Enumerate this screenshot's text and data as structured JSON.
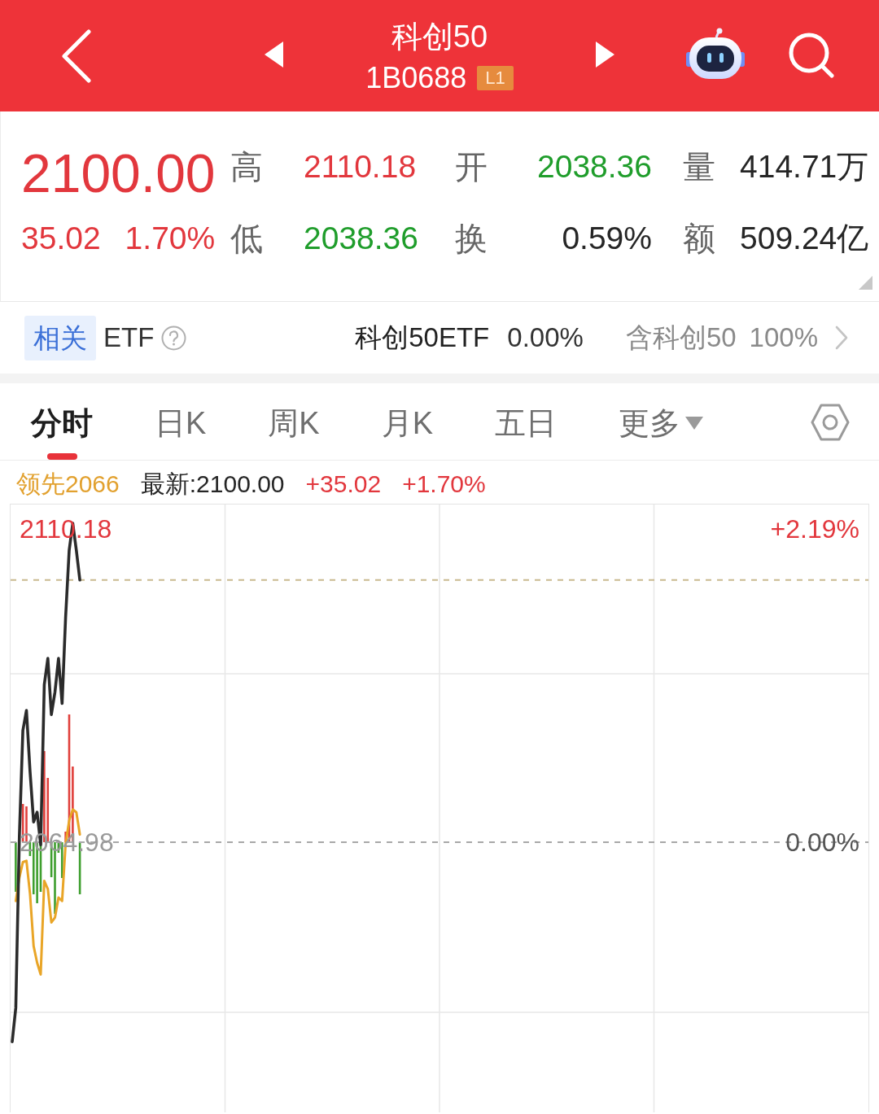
{
  "header": {
    "title": "科创50",
    "code": "1B0688",
    "level_badge": "L1"
  },
  "quote": {
    "price": {
      "text": "2100.00",
      "color": "#e2373d"
    },
    "change": {
      "text": "35.02",
      "color": "#e2373d"
    },
    "change_pct": {
      "text": "1.70%",
      "color": "#e2373d"
    },
    "stats": [
      {
        "label": "高",
        "value": "2110.18",
        "color": "#e2373d"
      },
      {
        "label": "开",
        "value": "2038.36",
        "color": "#1f9d2b"
      },
      {
        "label": "量",
        "value": "414.71万",
        "color": "#262626"
      },
      {
        "label": "低",
        "value": "2038.36",
        "color": "#1f9d2b"
      },
      {
        "label": "换",
        "value": "0.59%",
        "color": "#262626"
      },
      {
        "label": "额",
        "value": "509.24亿",
        "color": "#262626"
      }
    ]
  },
  "related_etf": {
    "tag": "相关",
    "title": "ETF",
    "etf_name": "科创50ETF",
    "etf_change": "0.00%",
    "holding_label": "含科创50",
    "holding_pct": "100%"
  },
  "tabs": [
    {
      "label": "分时",
      "selected": true,
      "kind": "tab"
    },
    {
      "label": "日K",
      "selected": false,
      "kind": "tab"
    },
    {
      "label": "周K",
      "selected": false,
      "kind": "tab"
    },
    {
      "label": "月K",
      "selected": false,
      "kind": "tab"
    },
    {
      "label": "五日",
      "selected": false,
      "kind": "tab"
    },
    {
      "label": "更多",
      "selected": false,
      "kind": "menu"
    }
  ],
  "indicator_line": [
    {
      "text": "领先2066",
      "kind": "leading"
    },
    {
      "text": "最新:2100.00",
      "kind": "latest"
    },
    {
      "text": "+35.02",
      "kind": "up"
    },
    {
      "text": "+1.70%",
      "kind": "up"
    }
  ],
  "chart": {
    "right_labels": [
      "+2.19%",
      "0.00%"
    ],
    "chart_data": {
      "type": "line",
      "categories": [
        null,
        null,
        null,
        null,
        null,
        null,
        null,
        null,
        null,
        null,
        null,
        null,
        null,
        null,
        null,
        null,
        null,
        null,
        null,
        null,
        null,
        null,
        null,
        null,
        null,
        null,
        null,
        null,
        null,
        null,
        null,
        null,
        null,
        null,
        null,
        null,
        null,
        null,
        null,
        null,
        null,
        null,
        null,
        null,
        null,
        null,
        null,
        null,
        null,
        null,
        null,
        null,
        null,
        null,
        null,
        null,
        null,
        null,
        null,
        null,
        null,
        null,
        null,
        null,
        null,
        null,
        null,
        null,
        null,
        null,
        null,
        null,
        null,
        null,
        null,
        null,
        null,
        null,
        null,
        null,
        null,
        null,
        null,
        null,
        null,
        null,
        null,
        null,
        null,
        null,
        null,
        null,
        null,
        null,
        null,
        null,
        null,
        null,
        null,
        null,
        null,
        null,
        null,
        null,
        null,
        null,
        null,
        null,
        null,
        null,
        null,
        null,
        null,
        null,
        null,
        null,
        null,
        null,
        null,
        null,
        null,
        null,
        null,
        null,
        null,
        null,
        null,
        null,
        null,
        null,
        null,
        null,
        null,
        null,
        null,
        null,
        null,
        null,
        null,
        null,
        null,
        null,
        null,
        null,
        null,
        null,
        null,
        null,
        null,
        null,
        null,
        null,
        null,
        null,
        null,
        null,
        null,
        null,
        null,
        null,
        null,
        null,
        null,
        null,
        null,
        null,
        null,
        null,
        null,
        null,
        null,
        null,
        null,
        null,
        null,
        null,
        null,
        null,
        null,
        null,
        null,
        null,
        null,
        null,
        null,
        null,
        null,
        null,
        null,
        null,
        null,
        null,
        null,
        null,
        null,
        null,
        null,
        null,
        null,
        null,
        null,
        null,
        null,
        null,
        null,
        null,
        null,
        null,
        null,
        null,
        null,
        null,
        null,
        null,
        null,
        null,
        null,
        null,
        null,
        null,
        null,
        null,
        null,
        null,
        null,
        null,
        null,
        null,
        null,
        null,
        null,
        null,
        null,
        null,
        null,
        null,
        null,
        null,
        null,
        null,
        null
      ],
      "ylim": [
        2026.0,
        2113.7
      ],
      "yticks": [
        {
          "value": 2110.18,
          "label": "2110.18"
        },
        {
          "value": 2064.98,
          "label": "2064.98"
        }
      ],
      "series": [
        {
          "color": "#e9a527",
          "values": [
            null,
            2056.5,
            2059.9,
            2062.1,
            2062.3,
            2057.5,
            2050.0,
            2047.6,
            2045.9,
            2059.4,
            2058.2,
            2053.4,
            2054.1,
            2057.0,
            2056.5,
            2064.7,
            2068.1,
            2069.7,
            2069.3,
            2066.1,
            null,
            null,
            null,
            null,
            null,
            null,
            null,
            null,
            null,
            null,
            null,
            null,
            null,
            null,
            null,
            null,
            null,
            null,
            null,
            null,
            null,
            null,
            null,
            null,
            null,
            null,
            null,
            null,
            null,
            null,
            null,
            null,
            null,
            null,
            null,
            null,
            null,
            null,
            null,
            null,
            null,
            null,
            null,
            null,
            null,
            null,
            null,
            null,
            null,
            null,
            null,
            null,
            null,
            null,
            null,
            null,
            null,
            null,
            null,
            null,
            null,
            null,
            null,
            null,
            null,
            null,
            null,
            null,
            null,
            null,
            null,
            null,
            null,
            null,
            null,
            null,
            null,
            null,
            null,
            null,
            null,
            null,
            null,
            null,
            null,
            null,
            null,
            null,
            null,
            null,
            null,
            null,
            null,
            null,
            null,
            null,
            null,
            null,
            null,
            null,
            null,
            null,
            null,
            null,
            null,
            null,
            null,
            null,
            null,
            null,
            null,
            null,
            null,
            null,
            null,
            null,
            null,
            null,
            null,
            null,
            null,
            null,
            null,
            null,
            null,
            null,
            null,
            null,
            null,
            null,
            null,
            null,
            null,
            null,
            null,
            null,
            null,
            null,
            null,
            null,
            null,
            null,
            null,
            null,
            null,
            null,
            null,
            null,
            null,
            null,
            null,
            null,
            null,
            null,
            null,
            null,
            null,
            null,
            null,
            null,
            null,
            null,
            null,
            null,
            null,
            null,
            null,
            null,
            null,
            null,
            null,
            null,
            null,
            null,
            null,
            null,
            null,
            null,
            null,
            null,
            null,
            null,
            null,
            null,
            null,
            null,
            null,
            null,
            null,
            null,
            null,
            null,
            null,
            null,
            null,
            null,
            null,
            null,
            null,
            null,
            null,
            null,
            null,
            null,
            null,
            null,
            null,
            null,
            null,
            null,
            null,
            null,
            null,
            null,
            null,
            null,
            null,
            null,
            null,
            null,
            null
          ]
        },
        {
          "color": "#2b2b2b",
          "values": [
            2036.2,
            2041.1,
            2065.8,
            2081.1,
            2084.0,
            2075.2,
            2067.9,
            2069.3,
            2064.6,
            2087.7,
            2091.5,
            2083.4,
            2086.6,
            2091.5,
            2085.0,
            2097.4,
            2107.1,
            2111.0,
            2107.1,
            2102.8,
            null,
            null,
            null,
            null,
            null,
            null,
            null,
            null,
            null,
            null,
            null,
            null,
            null,
            null,
            null,
            null,
            null,
            null,
            null,
            null,
            null,
            null,
            null,
            null,
            null,
            null,
            null,
            null,
            null,
            null,
            null,
            null,
            null,
            null,
            null,
            null,
            null,
            null,
            null,
            null,
            null,
            null,
            null,
            null,
            null,
            null,
            null,
            null,
            null,
            null,
            null,
            null,
            null,
            null,
            null,
            null,
            null,
            null,
            null,
            null,
            null,
            null,
            null,
            null,
            null,
            null,
            null,
            null,
            null,
            null,
            null,
            null,
            null,
            null,
            null,
            null,
            null,
            null,
            null,
            null,
            null,
            null,
            null,
            null,
            null,
            null,
            null,
            null,
            null,
            null,
            null,
            null,
            null,
            null,
            null,
            null,
            null,
            null,
            null,
            null,
            null,
            null,
            null,
            null,
            null,
            null,
            null,
            null,
            null,
            null,
            null,
            null,
            null,
            null,
            null,
            null,
            null,
            null,
            null,
            null,
            null,
            null,
            null,
            null,
            null,
            null,
            null,
            null,
            null,
            null,
            null,
            null,
            null,
            null,
            null,
            null,
            null,
            null,
            null,
            null,
            null,
            null,
            null,
            null,
            null,
            null,
            null,
            null,
            null,
            null,
            null,
            null,
            null,
            null,
            null,
            null,
            null,
            null,
            null,
            null,
            null,
            null,
            null,
            null,
            null,
            null,
            null,
            null,
            null,
            null,
            null,
            null,
            null,
            null,
            null,
            null,
            null,
            null,
            null,
            null,
            null,
            null,
            null,
            null,
            null,
            null,
            null,
            null,
            null,
            null,
            null,
            null,
            null,
            null,
            null,
            null,
            null,
            null,
            null,
            null,
            null,
            null,
            null,
            null,
            null,
            null,
            null,
            null,
            null,
            null,
            null,
            null,
            null,
            null,
            null,
            null,
            null,
            null,
            null,
            null,
            null
          ]
        }
      ],
      "ref_lines": [
        {
          "axis": "y",
          "value": 2102.8
        },
        {
          "axis": "y",
          "value": 2064.98
        }
      ]
    }
  }
}
